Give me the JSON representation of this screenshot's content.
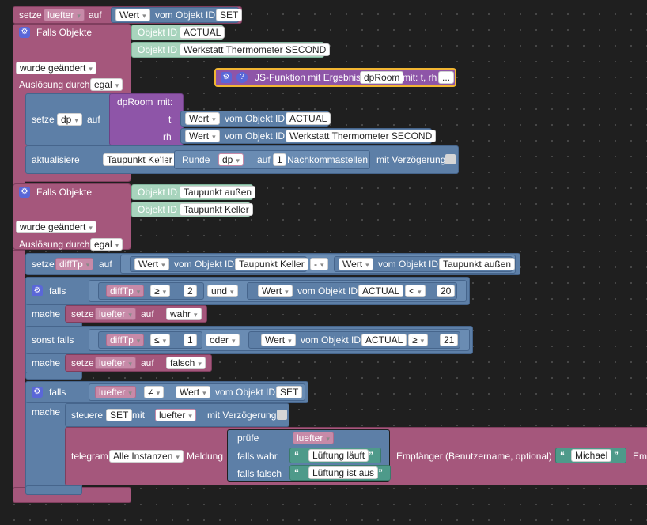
{
  "dropdown_arrow": "▾",
  "trigger1": {
    "setze": "setze",
    "var": "luefter",
    "auf": "auf",
    "wert": "Wert",
    "vom_objekt_id": "vom Objekt ID",
    "obj": "SET",
    "falls_objekte": "Falls Objekte",
    "objekt_id": "Objekt ID",
    "obj_a": "ACTUAL",
    "obj_b": "Werkstatt Thermometer SECOND",
    "wurde_geaendert": "wurde geändert",
    "ausloesung_durch": "Auslösung durch",
    "egal": "egal"
  },
  "js_function": {
    "label": "JS-Funktion mit Ergebnis",
    "name": "dpRoom",
    "mit": "mit: t, rh",
    "more": "..."
  },
  "setze_dp": {
    "setze": "setze",
    "var": "dp",
    "auf": "auf",
    "func": "dpRoom",
    "mit": "mit:",
    "p1": "t",
    "p2": "rh",
    "wert": "Wert",
    "vom_objekt_id": "vom Objekt ID",
    "obj_a": "ACTUAL",
    "obj_b": "Werkstatt Thermometer SECOND"
  },
  "aktualisiere": {
    "label": "aktualisiere",
    "target": "Taupunkt Keller",
    "mit": "mit",
    "runde": "Runde",
    "var": "dp",
    "auf": "auf",
    "digits": "1",
    "nachkomma": "Nachkommastellen",
    "verzoegerung": "mit Verzögerung"
  },
  "trigger2": {
    "falls_objekte": "Falls Objekte",
    "objekt_id": "Objekt ID",
    "obj_a": "Taupunkt außen",
    "obj_b": "Taupunkt Keller",
    "wurde_geaendert": "wurde geändert",
    "ausloesung_durch": "Auslösung durch",
    "egal": "egal",
    "setze": "setze",
    "var": "diffTp",
    "auf": "auf",
    "wert": "Wert",
    "vom_objekt_id": "vom Objekt ID",
    "obj1": "Taupunkt Keller",
    "op": "-",
    "obj2": "Taupunkt außen"
  },
  "if1": {
    "falls": "falls",
    "var": "diffTp",
    "op1": "≥",
    "n1": "2",
    "und": "und",
    "wert": "Wert",
    "vom_objekt_id": "vom Objekt ID",
    "obj": "ACTUAL",
    "op2": "<",
    "n2": "20",
    "mache": "mache",
    "setze": "setze",
    "v": "luefter",
    "auf": "auf",
    "val": "wahr",
    "sonst_falls": "sonst falls",
    "op3": "≤",
    "n3": "1",
    "oder": "oder",
    "op4": "≥",
    "n4": "21",
    "val2": "falsch"
  },
  "if2": {
    "falls": "falls",
    "var": "luefter",
    "op": "≠",
    "wert": "Wert",
    "vom_objekt_id": "vom Objekt ID",
    "obj": "SET",
    "mache": "mache",
    "steuere": "steuere",
    "target": "SET",
    "mit": "mit",
    "verzoegerung": "mit Verzögerung"
  },
  "telegram": {
    "label": "telegram",
    "instance": "Alle Instanzen",
    "meldung": "Meldung",
    "pruefe": "prüfe",
    "var": "luefter",
    "falls_wahr": "falls wahr",
    "text_wahr": "Lüftung läuft",
    "falls_falsch": "falls falsch",
    "text_falsch": "Lüftung ist aus",
    "empfaenger": "Empfänger (Benutzername, optional)",
    "user": "Michael",
    "em": "Em"
  }
}
